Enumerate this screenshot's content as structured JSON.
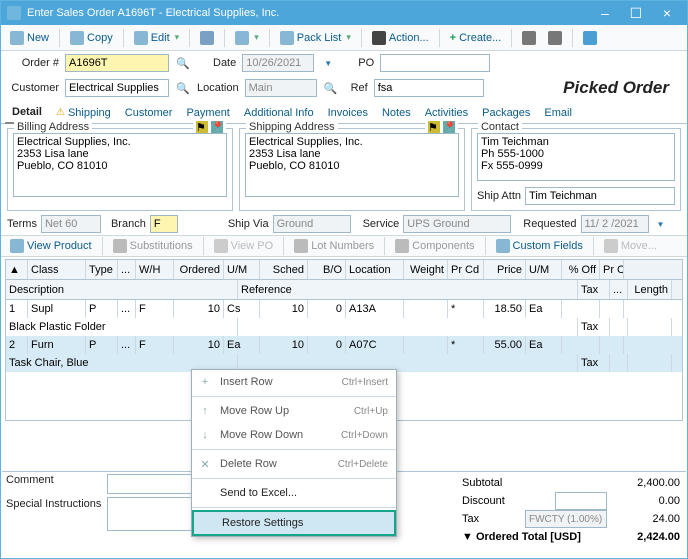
{
  "window": {
    "title": "Enter Sales Order A1696T - Electrical Supplies, Inc.",
    "min": "–",
    "max": "☐",
    "close": "×"
  },
  "toolbar": {
    "new": "New",
    "copy": "Copy",
    "edit": "Edit",
    "packlist": "Pack List",
    "action": "Action...",
    "create": "Create..."
  },
  "header": {
    "order_lbl": "Order #",
    "order": "A1696T",
    "date_lbl": "Date",
    "date": "10/26/2021",
    "po_lbl": "PO",
    "po": "",
    "cust_lbl": "Customer",
    "cust": "Electrical Supplies",
    "loc_lbl": "Location",
    "loc": "Main",
    "ref_lbl": "Ref",
    "ref": "fsa",
    "picked": "Picked Order"
  },
  "tabs": {
    "detail": "Detail",
    "shipping": "Shipping",
    "customer": "Customer",
    "payment": "Payment",
    "addl": "Additional Info",
    "invoices": "Invoices",
    "notes": "Notes",
    "activities": "Activities",
    "packages": "Packages",
    "email": "Email"
  },
  "billing": {
    "title": "Billing Address",
    "text": "Electrical Supplies, Inc.\n2353 Lisa lane\nPueblo, CO 81010"
  },
  "shipping": {
    "title": "Shipping Address",
    "text": "Electrical Supplies, Inc.\n2353 Lisa lane\nPueblo, CO 81010"
  },
  "contact": {
    "title": "Contact",
    "text": "Tim Teichman\nPh 555-1000\nFx 555-0999",
    "shipattn_lbl": "Ship Attn",
    "shipattn": "Tim Teichman"
  },
  "row2": {
    "terms_lbl": "Terms",
    "terms": "Net 60",
    "branch_lbl": "Branch",
    "branch": "F",
    "shipvia_lbl": "Ship Via",
    "shipvia": "Ground",
    "service_lbl": "Service",
    "service": "UPS Ground",
    "requested_lbl": "Requested",
    "requested": "11/ 2 /2021"
  },
  "minibar": {
    "view": "View Product",
    "subs": "Substitutions",
    "viewpo": "View PO",
    "lots": "Lot Numbers",
    "comp": "Components",
    "custom": "Custom Fields",
    "move": "Move..."
  },
  "gridhead": {
    "n": "▲",
    "class": "Class",
    "type": "Type",
    "dd": "...",
    "wh": "W/H",
    "ord": "Ordered",
    "um": "U/M",
    "sch": "Sched",
    "bo": "B/O",
    "loc": "Location",
    "wt": "Weight",
    "prcd": "Pr Cd",
    "price": "Price",
    "um2": "U/M",
    "off": "% Off",
    "prc": "Pr C",
    "desc": "Description",
    "ref": "Reference",
    "tax": "Tax",
    "btn": "...",
    "len": "Length"
  },
  "rows": [
    {
      "n": "1",
      "class": "Supl",
      "type": "P",
      "dd": "...",
      "wh": "F",
      "ord": "10",
      "um": "Cs",
      "sch": "10",
      "bo": "0",
      "loc": "A13A",
      "wt": "",
      "prcd": "*",
      "price": "18.50",
      "um2": "Ea",
      "off": "",
      "prc": "",
      "desc": "Black Plastic Folder",
      "ref": "",
      "tax": "Tax",
      "btn": "",
      "len": ""
    },
    {
      "n": "2",
      "class": "Furn",
      "type": "P",
      "dd": "...",
      "wh": "F",
      "ord": "10",
      "um": "Ea",
      "sch": "10",
      "bo": "0",
      "loc": "A07C",
      "wt": "",
      "prcd": "*",
      "price": "55.00",
      "um2": "Ea",
      "off": "",
      "prc": "",
      "desc": "Task Chair, Blue",
      "ref": "",
      "tax": "Tax",
      "btn": "",
      "len": ""
    }
  ],
  "ctx": {
    "insert": "Insert Row",
    "insert_sc": "Ctrl+Insert",
    "up": "Move Row Up",
    "up_sc": "Ctrl+Up",
    "down": "Move Row Down",
    "down_sc": "Ctrl+Down",
    "del": "Delete Row",
    "del_sc": "Ctrl+Delete",
    "excel": "Send to Excel...",
    "restore": "Restore Settings"
  },
  "bottom": {
    "comment_lbl": "Comment",
    "special_lbl": "Special Instructions",
    "subtotal_lbl": "Subtotal",
    "subtotal": "2,400.00",
    "discount_lbl": "Discount",
    "discount": "0.00",
    "tax_lbl": "Tax",
    "tax_code": "FWCTY (1.00%)",
    "tax": "24.00",
    "total_lbl": "▼ Ordered Total [USD]",
    "total": "2,424.00"
  }
}
